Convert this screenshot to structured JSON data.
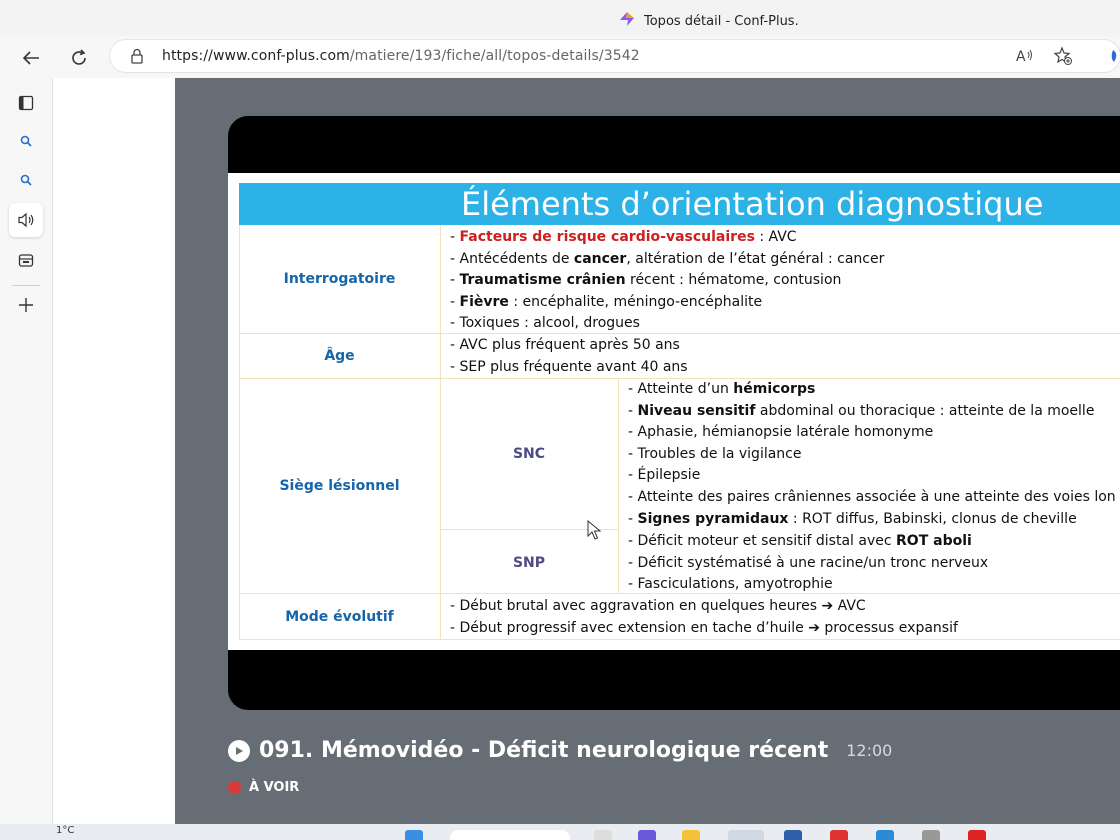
{
  "browser": {
    "tab_title": "Topos détail - Conf-Plus.",
    "url_host": "https://www.conf-plus.com",
    "url_path": "/matiere/193/fiche/all/topos-details/3542"
  },
  "slide": {
    "title": "Éléments d’orientation diagnostique",
    "rows": {
      "interrogatoire": {
        "label": "Interrogatoire",
        "l1_red": "Facteurs de risque cardio-vasculaires",
        "l1_rest": " : AVC",
        "l2_a": "- Antécédents de ",
        "l2_b": "cancer",
        "l2_c": ", altération de l’état général : cancer",
        "l3_b": "Traumatisme crânien",
        "l3_c": " récent : hématome, contusion",
        "l4_b": "Fièvre",
        "l4_c": " : encéphalite, méningo-encéphalite",
        "l5": "- Toxiques : alcool, drogues"
      },
      "age": {
        "label": "Âge",
        "l1": "- AVC plus fréquent après 50 ans",
        "l2": "- SEP plus fréquente avant 40 ans"
      },
      "siege": {
        "label": "Siège lésionnel",
        "snc": {
          "label": "SNC",
          "l1_a": "- Atteinte d’un ",
          "l1_b": "hémicorps",
          "l2_b": "Niveau sensitif",
          "l2_c": " abdominal ou thoracique : atteinte de la moelle",
          "l3": "- Aphasie, hémianopsie latérale homonyme",
          "l4": "- Troubles de la vigilance",
          "l5": "- Épilepsie",
          "l6": "- Atteinte des paires crâniennes associée à une atteinte des voies lon",
          "l7_b": "Signes pyramidaux",
          "l7_c": " : ROT diffus, Babinski, clonus de cheville"
        },
        "snp": {
          "label": "SNP",
          "l1_a": "- Déficit moteur et sensitif distal avec ",
          "l1_b": "ROT aboli",
          "l2": "- Déficit systématisé à une racine/un tronc nerveux",
          "l3": "- Fasciculations, amyotrophie"
        }
      },
      "mode": {
        "label": "Mode évolutif",
        "l1_a": "- Début brutal avec aggravation en quelques heures ",
        "l1_b": " AVC",
        "l2_a": "- Début progressif avec extension en tache d’huile ",
        "l2_b": " processus expansif"
      }
    }
  },
  "video": {
    "title": "091. Mémovidéo - Déficit neurologique récent",
    "duration": "12:00",
    "status": "À VOIR"
  },
  "taskbar": {
    "temperature": "1°C"
  },
  "icons": {
    "arrow": "➔"
  }
}
